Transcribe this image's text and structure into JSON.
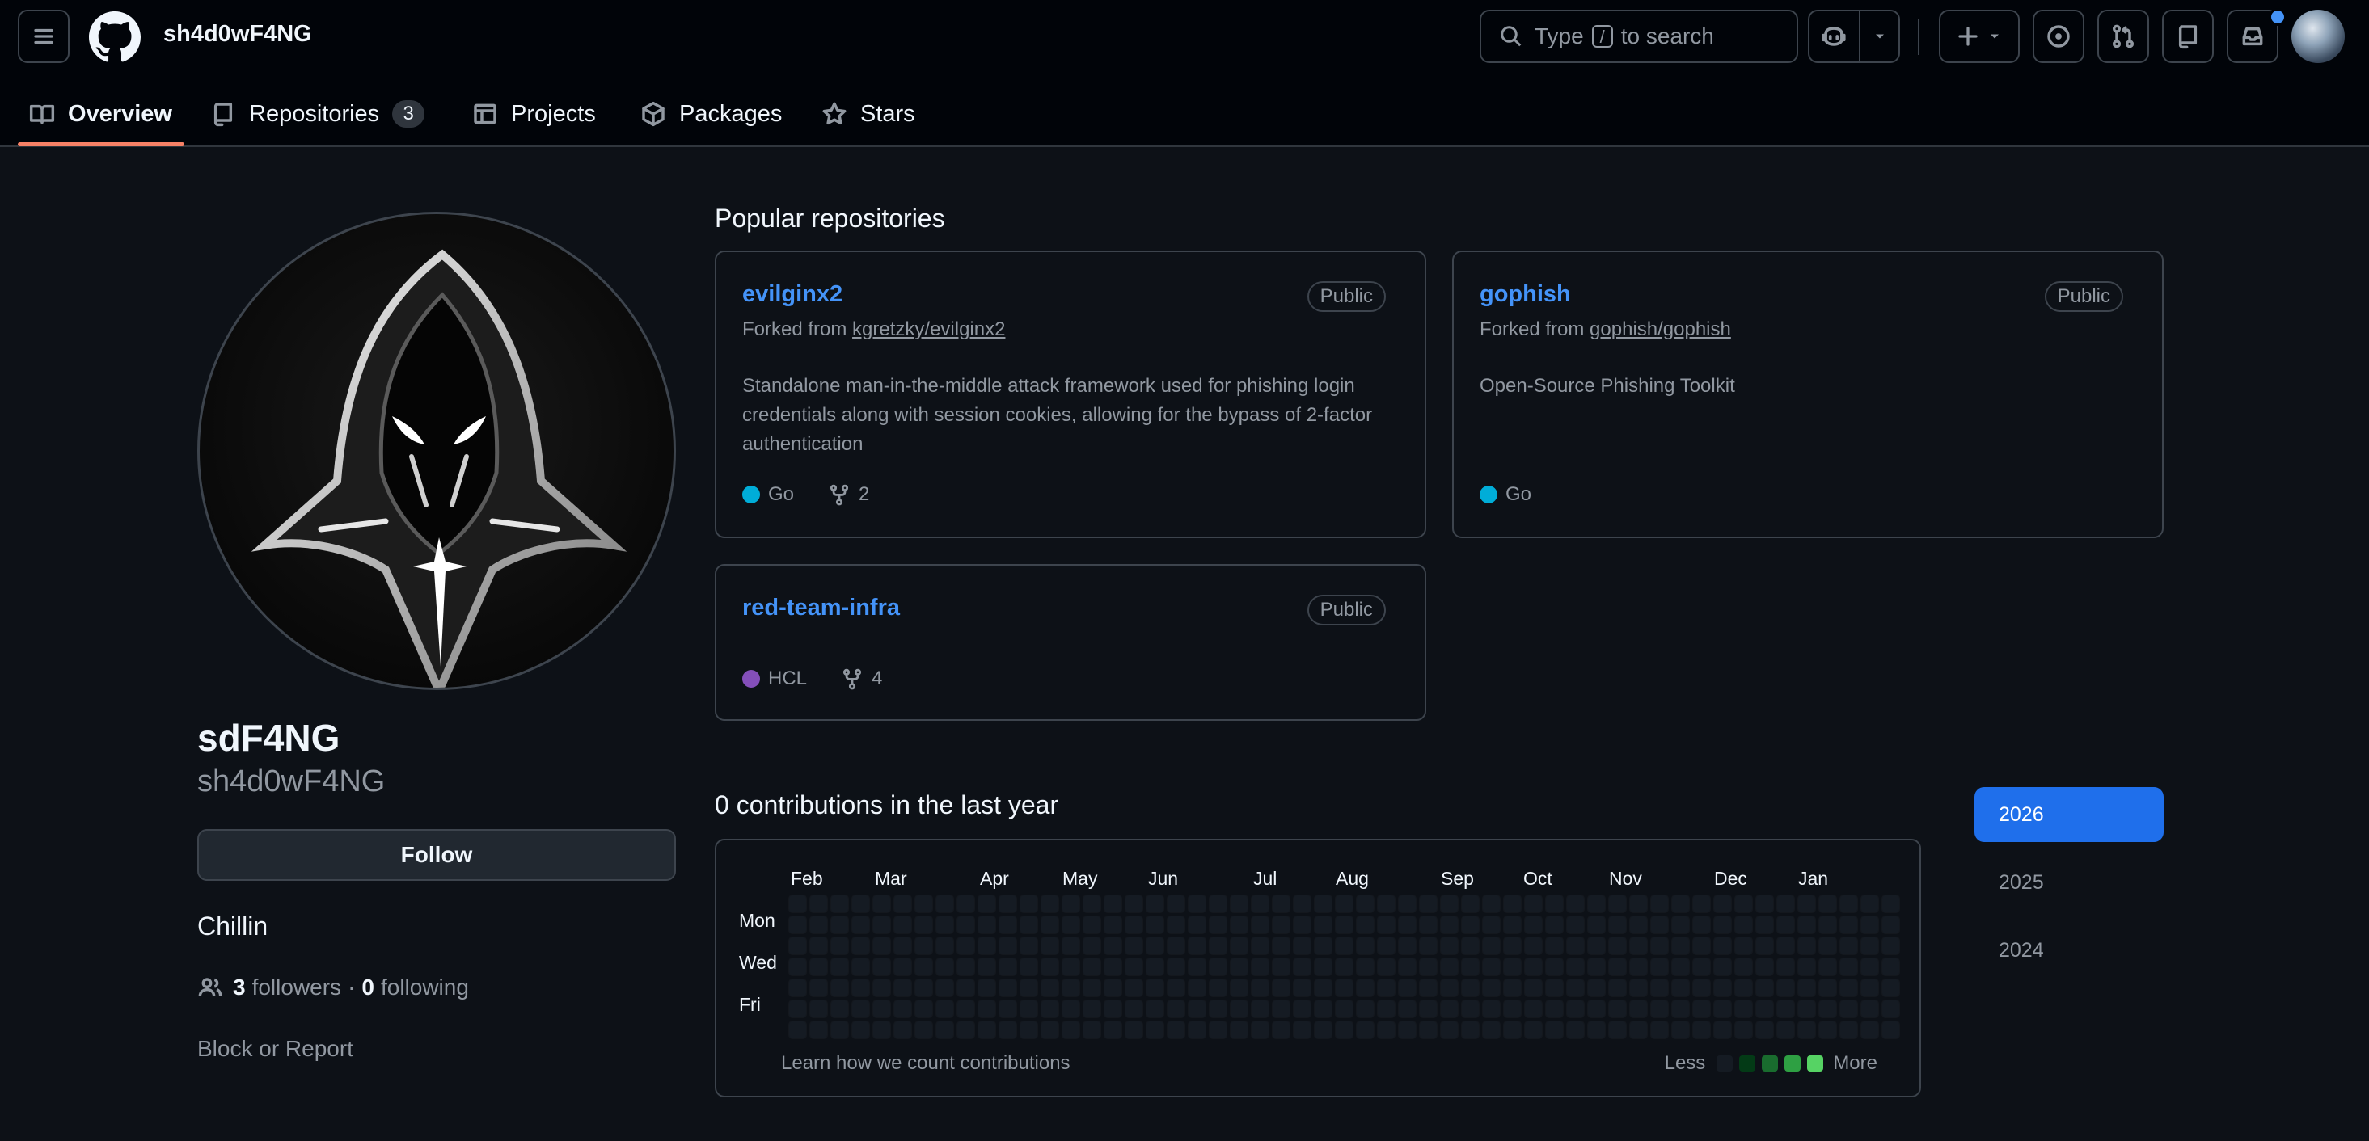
{
  "header": {
    "username": "sh4d0wF4NG",
    "search": {
      "prefix": "Type",
      "key": "/",
      "suffix": "to search"
    }
  },
  "tabs": [
    {
      "label": "Overview",
      "icon": "book-icon"
    },
    {
      "label": "Repositories",
      "icon": "repo-icon",
      "count": "3"
    },
    {
      "label": "Projects",
      "icon": "table-icon"
    },
    {
      "label": "Packages",
      "icon": "package-icon"
    },
    {
      "label": "Stars",
      "icon": "star-icon"
    }
  ],
  "profile": {
    "name": "sdF4NG",
    "login": "sh4d0wF4NG",
    "follow_label": "Follow",
    "bio": "Chillin",
    "followers_count": "3",
    "followers_label": "followers",
    "separator": "·",
    "following_count": "0",
    "following_label": "following",
    "block_label": "Block or Report"
  },
  "popular": {
    "title": "Popular repositories",
    "repos": [
      {
        "name": "evilginx2",
        "visibility": "Public",
        "forked_prefix": "Forked from",
        "forked_from": "kgretzky/evilginx2",
        "description": "Standalone man-in-the-middle attack framework used for phishing login credentials along with session cookies, allowing for the bypass of 2-factor authentication",
        "language": "Go",
        "language_color": "#00ADD8",
        "forks": "2"
      },
      {
        "name": "gophish",
        "visibility": "Public",
        "forked_prefix": "Forked from",
        "forked_from": "gophish/gophish",
        "description": "Open-Source Phishing Toolkit",
        "language": "Go",
        "language_color": "#00ADD8"
      },
      {
        "name": "red-team-infra",
        "visibility": "Public",
        "language": "HCL",
        "language_color": "#844FBA",
        "forks": "4"
      }
    ]
  },
  "contributions": {
    "title": "0 contributions in the last year",
    "months": [
      "Feb",
      "Mar",
      "Apr",
      "May",
      "Jun",
      "Jul",
      "Aug",
      "Sep",
      "Oct",
      "Nov",
      "Dec",
      "Jan"
    ],
    "days": [
      "Mon",
      "Wed",
      "Fri"
    ],
    "learn": "Learn how we count contributions",
    "less": "Less",
    "more": "More",
    "legend_colors": [
      "#151b23",
      "#033a16",
      "#196c2e",
      "#2ea043",
      "#56d364"
    ],
    "empty_color": "#151b23"
  },
  "years": [
    "2026",
    "2025",
    "2024"
  ]
}
